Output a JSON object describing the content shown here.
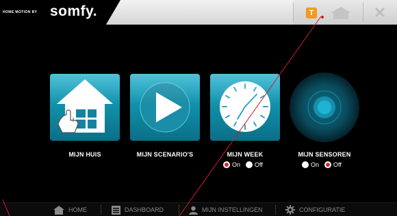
{
  "header": {
    "brand_tagline": "HOME MOTION BY",
    "brand_name": "somfy.",
    "notification_badge": "T"
  },
  "tiles": [
    {
      "label": "MIJN HUIS",
      "icon": "house-hand-icon"
    },
    {
      "label": "MIJN SCENARIO'S",
      "icon": "play-icon"
    },
    {
      "label": "MIJN WEEK",
      "icon": "clock-icon"
    },
    {
      "label": "MIJN SENSOREN",
      "icon": "sensor-glow-icon"
    }
  ],
  "week_toggle": {
    "on_label": "On",
    "off_label": "Off",
    "selected": "On"
  },
  "sensor_toggle": {
    "on_label": "On",
    "off_label": "Off",
    "selected": "Off"
  },
  "bottom_nav": [
    {
      "label": "HOME",
      "icon": "home-icon"
    },
    {
      "label": "DASHBOARD",
      "icon": "dashboard-icon"
    },
    {
      "label": "MIJN INSTELLINGEN",
      "icon": "user-icon"
    },
    {
      "label": "CONFIGURATIE",
      "icon": "gear-icon"
    }
  ],
  "colors": {
    "accent_teal": "#1a9fbb",
    "badge_orange": "#f29a1b",
    "radio_red": "#d3262c",
    "background": "#000000"
  }
}
